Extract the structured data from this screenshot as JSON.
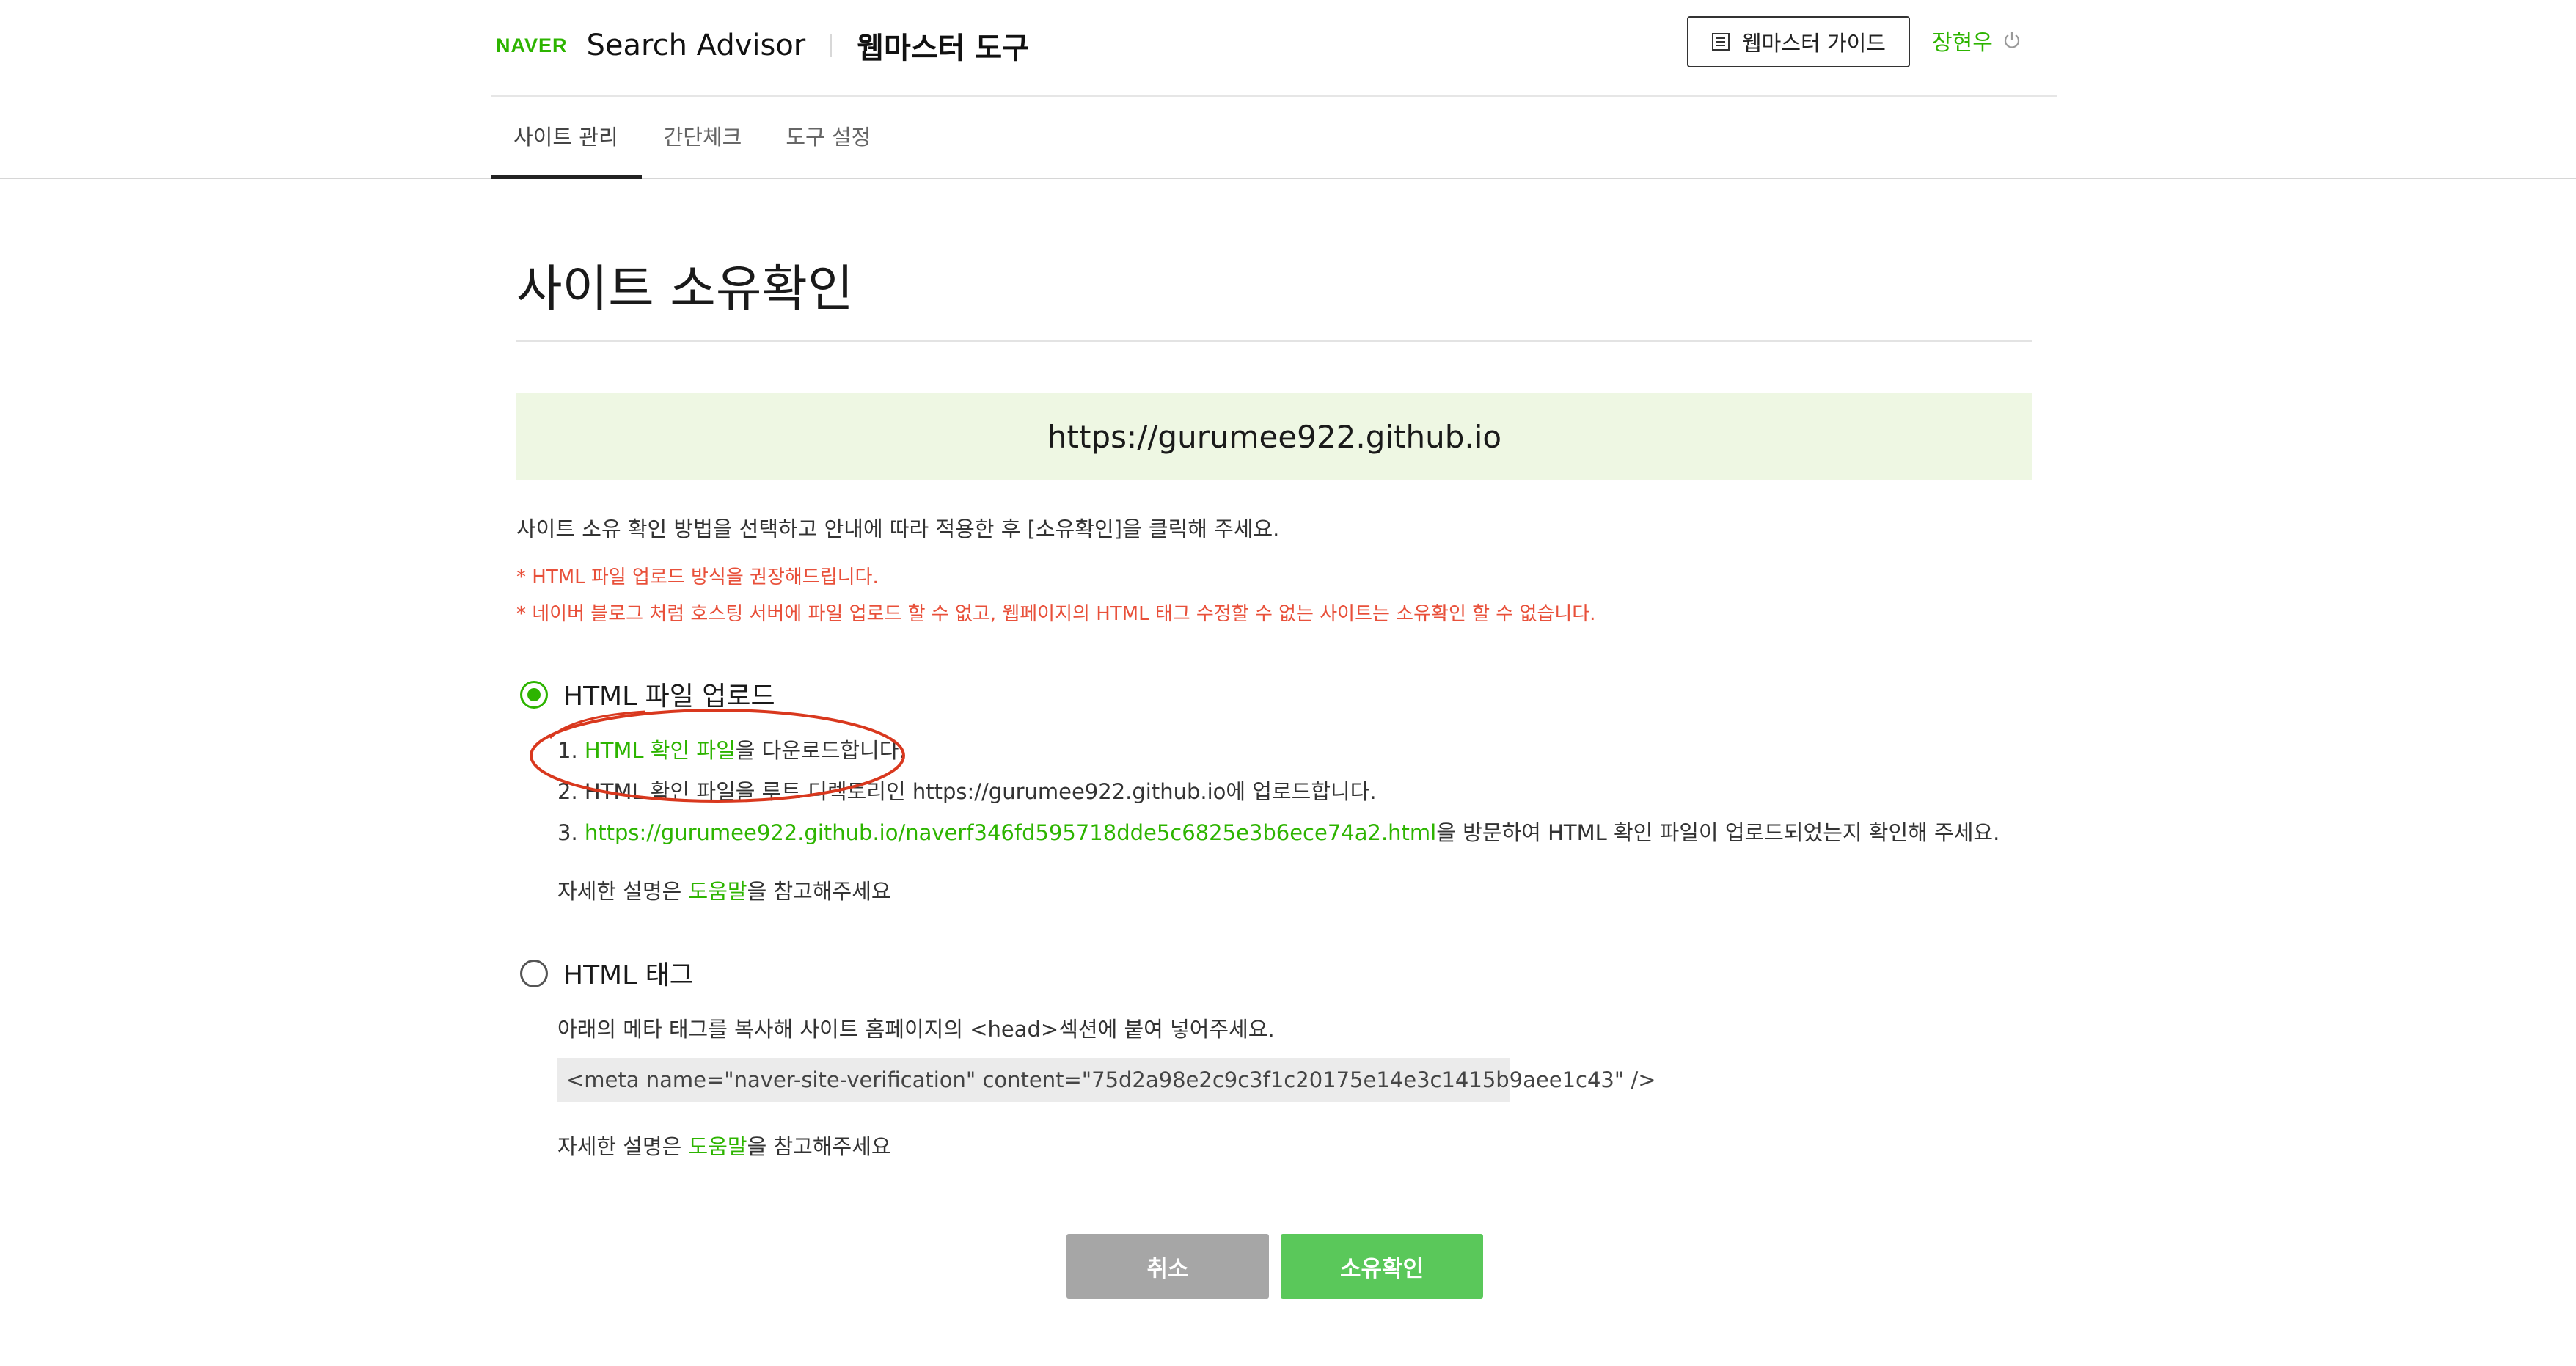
{
  "header": {
    "logo": "NAVER",
    "brand": "Search Advisor",
    "tool": "웹마스터 도구",
    "guide_button": "웹마스터 가이드",
    "user": "장현우"
  },
  "tabs": [
    {
      "label": "사이트 관리",
      "active": true
    },
    {
      "label": "간단체크",
      "active": false
    },
    {
      "label": "도구 설정",
      "active": false
    }
  ],
  "page": {
    "title": "사이트 소유확인",
    "site_url": "https://gurumee922.github.io",
    "instruction": "사이트 소유 확인 방법을 선택하고 안내에 따라 적용한 후 [소유확인]을 클릭해 주세요.",
    "warnings": [
      "* HTML 파일 업로드 방식을 권장해드립니다.",
      "* 네이버 블로그 처럼 호스팅 서버에 파일 업로드 할 수 없고, 웹페이지의 HTML 태그 수정할 수 없는 사이트는 소유확인 할 수 없습니다."
    ]
  },
  "option_file": {
    "label": "HTML 파일 업로드",
    "selected": true,
    "step1_prefix": "1. ",
    "step1_link": "HTML 확인 파일",
    "step1_suffix": "을 다운로드합니다.",
    "step2": "2. HTML 확인 파일을 루트 디렉토리인 https://gurumee922.github.io에 업로드합니다.",
    "step3_prefix": "3. ",
    "step3_link": "https://gurumee922.github.io/naverf346fd595718dde5c6825e3b6ece74a2.html",
    "step3_suffix": "을 방문하여 HTML 확인 파일이 업로드되었는지 확인해 주세요.",
    "help_prefix": "자세한 설명은 ",
    "help_link": "도움말",
    "help_suffix": "을 참고해주세요"
  },
  "option_tag": {
    "label": "HTML 태그",
    "selected": false,
    "description": "아래의 메타 태그를 복사해 사이트 홈페이지의 <head>섹션에 붙여 넣어주세요.",
    "meta_tag": "<meta name=\"naver-site-verification\" content=\"75d2a98e2c9c3f1c20175e14e3c1415b9aee1c43\" />",
    "help_prefix": "자세한 설명은 ",
    "help_link": "도움말",
    "help_suffix": "을 참고해주세요"
  },
  "actions": {
    "cancel": "취소",
    "confirm": "소유확인"
  },
  "colors": {
    "brand_green": "#2db400",
    "warning_red": "#e8503a",
    "url_box_bg": "#eef7e3",
    "cancel_gray": "#a6a6a6",
    "confirm_green": "#5ac85a",
    "annotation_red": "#d9381e"
  },
  "icons": [
    "guide-book-icon",
    "power-icon",
    "radio-checked-icon",
    "radio-unchecked-icon"
  ]
}
